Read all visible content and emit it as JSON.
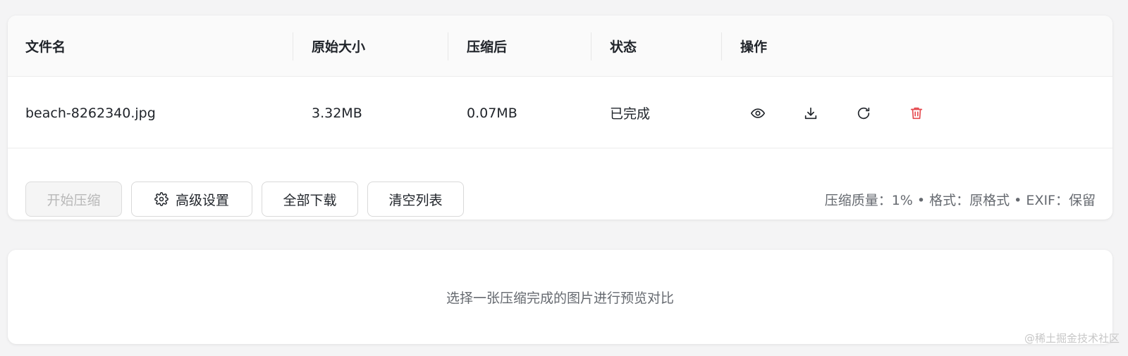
{
  "table": {
    "headers": {
      "filename": "文件名",
      "original_size": "原始大小",
      "compressed": "压缩后",
      "status": "状态",
      "actions": "操作"
    },
    "rows": [
      {
        "filename": "beach-8262340.jpg",
        "original_size": "3.32MB",
        "compressed": "0.07MB",
        "status": "已完成"
      }
    ]
  },
  "toolbar": {
    "start_label": "开始压缩",
    "settings_label": "高级设置",
    "download_all_label": "全部下载",
    "clear_label": "清空列表"
  },
  "settings_info": "压缩质量：1% • 格式：原格式 • EXIF：保留",
  "preview": {
    "placeholder": "选择一张压缩完成的图片进行预览对比"
  },
  "watermark": "@稀土掘金技术社区",
  "icons": {
    "preview": "eye-icon",
    "download": "download-icon",
    "retry": "refresh-icon",
    "delete": "trash-icon",
    "settings": "gear-icon"
  },
  "colors": {
    "danger": "#e5484d",
    "text": "#1f2329",
    "muted": "#666a70"
  }
}
